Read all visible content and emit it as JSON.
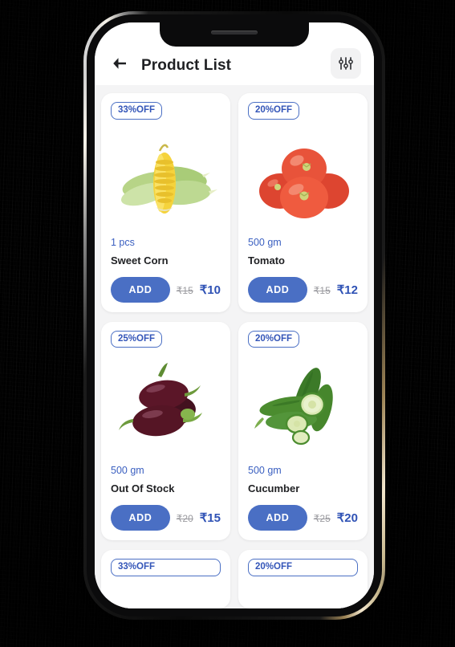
{
  "header": {
    "title": "Product List",
    "back_icon": "arrow-left-icon",
    "filter_icon": "sliders-filter-icon"
  },
  "currency_symbol": "₹",
  "colors": {
    "accent_blue": "#4a6fc4",
    "price_blue": "#2f52b5",
    "badge_border": "#4a6fc4",
    "content_bg": "#f4f4f5",
    "card_bg": "#ffffff",
    "title_text": "#1f2023",
    "old_price": "#9a9a9f"
  },
  "products": [
    {
      "discount": "33%OFF",
      "weight": "1 pcs",
      "name": "Sweet Corn",
      "add_label": "ADD",
      "old_price": "₹15",
      "new_price": "₹10",
      "image": "sweet-corn-image"
    },
    {
      "discount": "20%OFF",
      "weight": "500 gm",
      "name": "Tomato",
      "add_label": "ADD",
      "old_price": "₹15",
      "new_price": "₹12",
      "image": "tomato-image"
    },
    {
      "discount": "25%OFF",
      "weight": "500 gm",
      "name": "Out Of Stock",
      "add_label": "ADD",
      "old_price": "₹20",
      "new_price": "₹15",
      "image": "brinjal-image"
    },
    {
      "discount": "20%OFF",
      "weight": "500 gm",
      "name": "Cucumber",
      "add_label": "ADD",
      "old_price": "₹25",
      "new_price": "₹20",
      "image": "cucumber-image"
    }
  ],
  "next_row_peek": [
    {
      "discount": "33%OFF"
    },
    {
      "discount": "20%OFF"
    }
  ]
}
